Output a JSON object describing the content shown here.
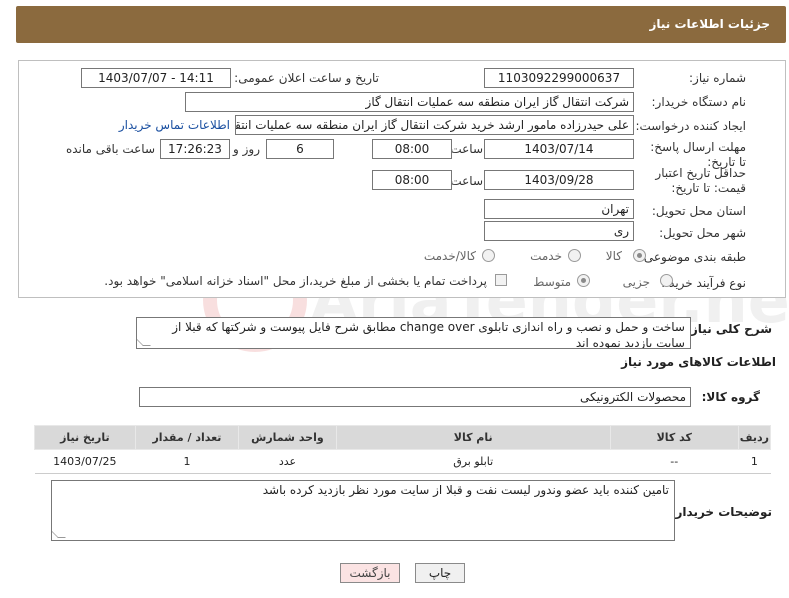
{
  "header": {
    "title": "جزئیات اطلاعات نیاز"
  },
  "form": {
    "need_number_label": "شماره نیاز:",
    "need_number": "1103092299000637",
    "announce_label": "تاریخ و ساعت اعلان عمومی:",
    "announce_value": "1403/07/07 - 14:11",
    "buyer_org_label": "نام دستگاه خریدار:",
    "buyer_org": "شرکت انتقال گاز ایران منطقه سه عملیات انتقال گاز",
    "creator_label": "ایجاد کننده درخواست:",
    "creator": "علی حیدرزاده مامور ارشد خرید شرکت انتقال گاز ایران منطقه سه عملیات انتقال گاز",
    "contact_link": "اطلاعات تماس خریدار",
    "reply_deadline_label": "مهلت ارسال پاسخ: تا تاریخ:",
    "reply_date": "1403/07/14",
    "time_label": "ساعت",
    "reply_time": "08:00",
    "days_value": "6",
    "days_label": "روز و",
    "remaining_time": "17:26:23",
    "remaining_label": "ساعت باقی مانده",
    "validity_label": "حداقل تاریخ اعتبار قیمت: تا تاریخ:",
    "validity_date": "1403/09/28",
    "validity_time": "08:00",
    "province_label": "استان محل تحویل:",
    "province": "تهران",
    "city_label": "شهر محل تحویل:",
    "city": "ری",
    "category_label": "طبقه بندی موضوعی:",
    "category_options": [
      "کالا",
      "خدمت",
      "کالا/خدمت"
    ],
    "process_label": "نوع فرآیند خرید :",
    "process_options": [
      "جزیی",
      "متوسط"
    ],
    "payment_note": "پرداخت تمام یا بخشی از مبلغ خرید،از محل \"اسناد خزانه اسلامی\" خواهد بود."
  },
  "description": {
    "label": "شرح کلی نیاز:",
    "text": "ساخت و حمل و نصب و راه اندازی تابلوی change over مطابق شرح فایل پیوست و شرکتها که قبلا از سایت بازدید نموده اند"
  },
  "goods": {
    "section_title": "اطلاعات کالاهای مورد نیاز",
    "group_label": "گروه کالا:",
    "group_value": "محصولات الکترونیکی",
    "columns": [
      "ردیف",
      "کد کالا",
      "نام کالا",
      "واحد شمارش",
      "تعداد / مقدار",
      "تاریخ نیاز"
    ],
    "rows": [
      [
        "1",
        "--",
        "تابلو برق",
        "عدد",
        "1",
        "1403/07/25"
      ]
    ]
  },
  "buyer_notes": {
    "label": "توضیحات خریدار:",
    "text": "تامین کننده باید عضو وندور لیست نفت و قبلا از سایت مورد نظر بازدید کرده باشد"
  },
  "buttons": {
    "print": "چاپ",
    "back": "بازگشت"
  },
  "watermark": {
    "text": "AriaTender.neT"
  }
}
